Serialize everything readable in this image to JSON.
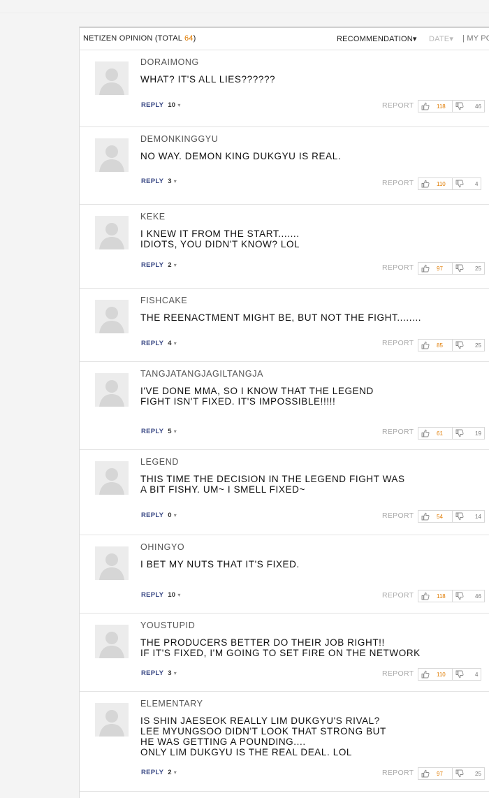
{
  "header": {
    "title": "NETIZEN OPINION (TOTAL ",
    "total": "64",
    "title_end": ")",
    "recommendation": "RECOMMENDATION▾",
    "date": "DATE▾",
    "mypo": "| MY PO"
  },
  "colors": {
    "accent": "#e07b00",
    "reply": "#3b4a86"
  },
  "labels": {
    "reply": "REPLY",
    "report": "REPORT"
  },
  "comments": [
    {
      "user": "DORAIMONG",
      "text": "WHAT? IT'S ALL LIES??????",
      "replies": "10",
      "up": "118",
      "down": "46"
    },
    {
      "user": "DEMONKINGGYU",
      "text": "NO WAY. DEMON KING DUKGYU IS REAL.",
      "replies": "3",
      "up": "110",
      "down": "4"
    },
    {
      "user": "KEKE",
      "text": "I KNEW IT FROM THE START.......\nIDIOTS, YOU DIDN'T KNOW? LOL",
      "replies": "2",
      "up": "97",
      "down": "25"
    },
    {
      "user": "FISHCAKE",
      "text": "THE REENACTMENT MIGHT BE, BUT NOT THE FIGHT........",
      "replies": "4",
      "up": "85",
      "down": "25"
    },
    {
      "user": "TANGJATANGJAGILTANGJA",
      "text": "I'VE DONE MMA, SO I KNOW THAT THE LEGEND\nFIGHT ISN'T FIXED. IT'S IMPOSSIBLE!!!!!",
      "replies": "5",
      "up": "61",
      "down": "19"
    },
    {
      "user": "LEGEND",
      "text": "THIS TIME THE DECISION IN THE LEGEND FIGHT WAS\nA BIT FISHY. UM~ I SMELL FIXED~",
      "replies": "0",
      "up": "54",
      "down": "14"
    },
    {
      "user": "OHINGYO",
      "text": "I BET MY NUTS THAT IT'S FIXED.",
      "replies": "10",
      "up": "118",
      "down": "46"
    },
    {
      "user": "YOUSTUPID",
      "text": "THE PRODUCERS BETTER DO THEIR JOB RIGHT!!\nIF IT'S FIXED, I'M GOING TO SET FIRE ON THE NETWORK",
      "replies": "3",
      "up": "110",
      "down": "4"
    },
    {
      "user": "ELEMENTARY",
      "text": "IS SHIN JAESEOK REALLY LIM DUKGYU'S RIVAL?\nLEE MYUNGSOO DIDN'T LOOK THAT STRONG BUT\nHE WAS GETTING A POUNDING....\nONLY LIM DUKGYU IS THE REAL DEAL. LOL",
      "replies": "2",
      "up": "97",
      "down": "25"
    }
  ]
}
